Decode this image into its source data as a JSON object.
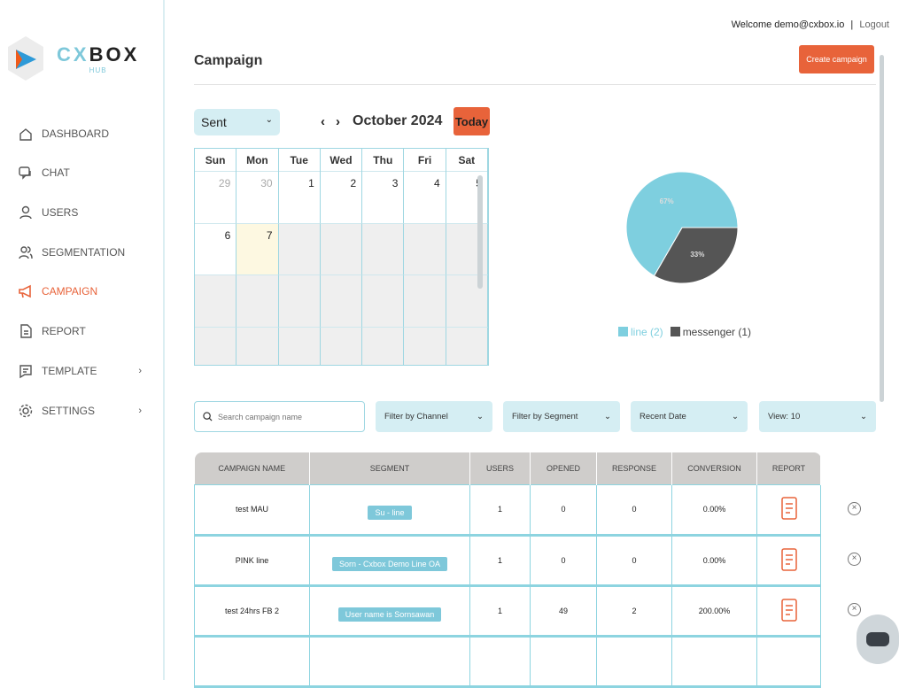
{
  "brand": {
    "name_part1": "CX",
    "name_part2": "BOX",
    "sub": "HUB"
  },
  "sidebar": {
    "items": [
      {
        "label": "DASHBOARD",
        "icon": "home-icon"
      },
      {
        "label": "CHAT",
        "icon": "chat-icon"
      },
      {
        "label": "USERS",
        "icon": "user-icon"
      },
      {
        "label": "SEGMENTATION",
        "icon": "users-icon"
      },
      {
        "label": "CAMPAIGN",
        "icon": "megaphone-icon",
        "active": true
      },
      {
        "label": "REPORT",
        "icon": "document-icon"
      },
      {
        "label": "TEMPLATE",
        "icon": "template-icon",
        "chevron": "›"
      },
      {
        "label": "SETTINGS",
        "icon": "gear-icon",
        "chevron": "›"
      }
    ]
  },
  "header": {
    "welcome": "Welcome demo@cxbox.io",
    "separator": "|",
    "logout": "Logout",
    "title": "Campaign",
    "create_button": "Create campaign"
  },
  "calendar": {
    "status_select": "Sent",
    "prev": "‹",
    "next": "›",
    "month": "October 2024",
    "today_button": "Today",
    "weekdays": [
      "Sun",
      "Mon",
      "Tue",
      "Wed",
      "Thu",
      "Fri",
      "Sat"
    ],
    "days": [
      "29",
      "30",
      "1",
      "2",
      "3",
      "4",
      "5",
      "6",
      "7"
    ],
    "today": "7"
  },
  "chart_data": {
    "type": "pie",
    "slices": [
      {
        "label": "line",
        "count": 2,
        "percent": 67,
        "color": "#7ecfdf"
      },
      {
        "label": "messenger",
        "count": 1,
        "percent": 33,
        "color": "#555555"
      }
    ],
    "slice_labels": [
      "67%",
      "33%"
    ],
    "legend": [
      "line (2)",
      "messenger (1)"
    ],
    "legend_placement": "bottom"
  },
  "filters": {
    "search_placeholder": "Search campaign name",
    "channel": "Filter by Channel",
    "segment": "Filter by Segment",
    "date": "Recent Date",
    "view": "View: 10"
  },
  "table": {
    "columns": [
      "CAMPAIGN NAME",
      "SEGMENT",
      "USERS",
      "OPENED",
      "RESPONSE",
      "CONVERSION",
      "REPORT"
    ],
    "rows": [
      {
        "name": "test MAU",
        "segment": "Su - line",
        "users": "1",
        "opened": "0",
        "response": "0",
        "conversion": "0.00%"
      },
      {
        "name": "PINK line",
        "segment": "Sorn - Cxbox Demo Line OA",
        "users": "1",
        "opened": "0",
        "response": "0",
        "conversion": "0.00%"
      },
      {
        "name": "test 24hrs FB 2",
        "segment": "User name is Sornsawan",
        "users": "1",
        "opened": "49",
        "response": "2",
        "conversion": "200.00%"
      }
    ]
  },
  "colors": {
    "accent": "#e8633a",
    "teal": "#7ec8da",
    "light_teal": "#d5eef3"
  }
}
